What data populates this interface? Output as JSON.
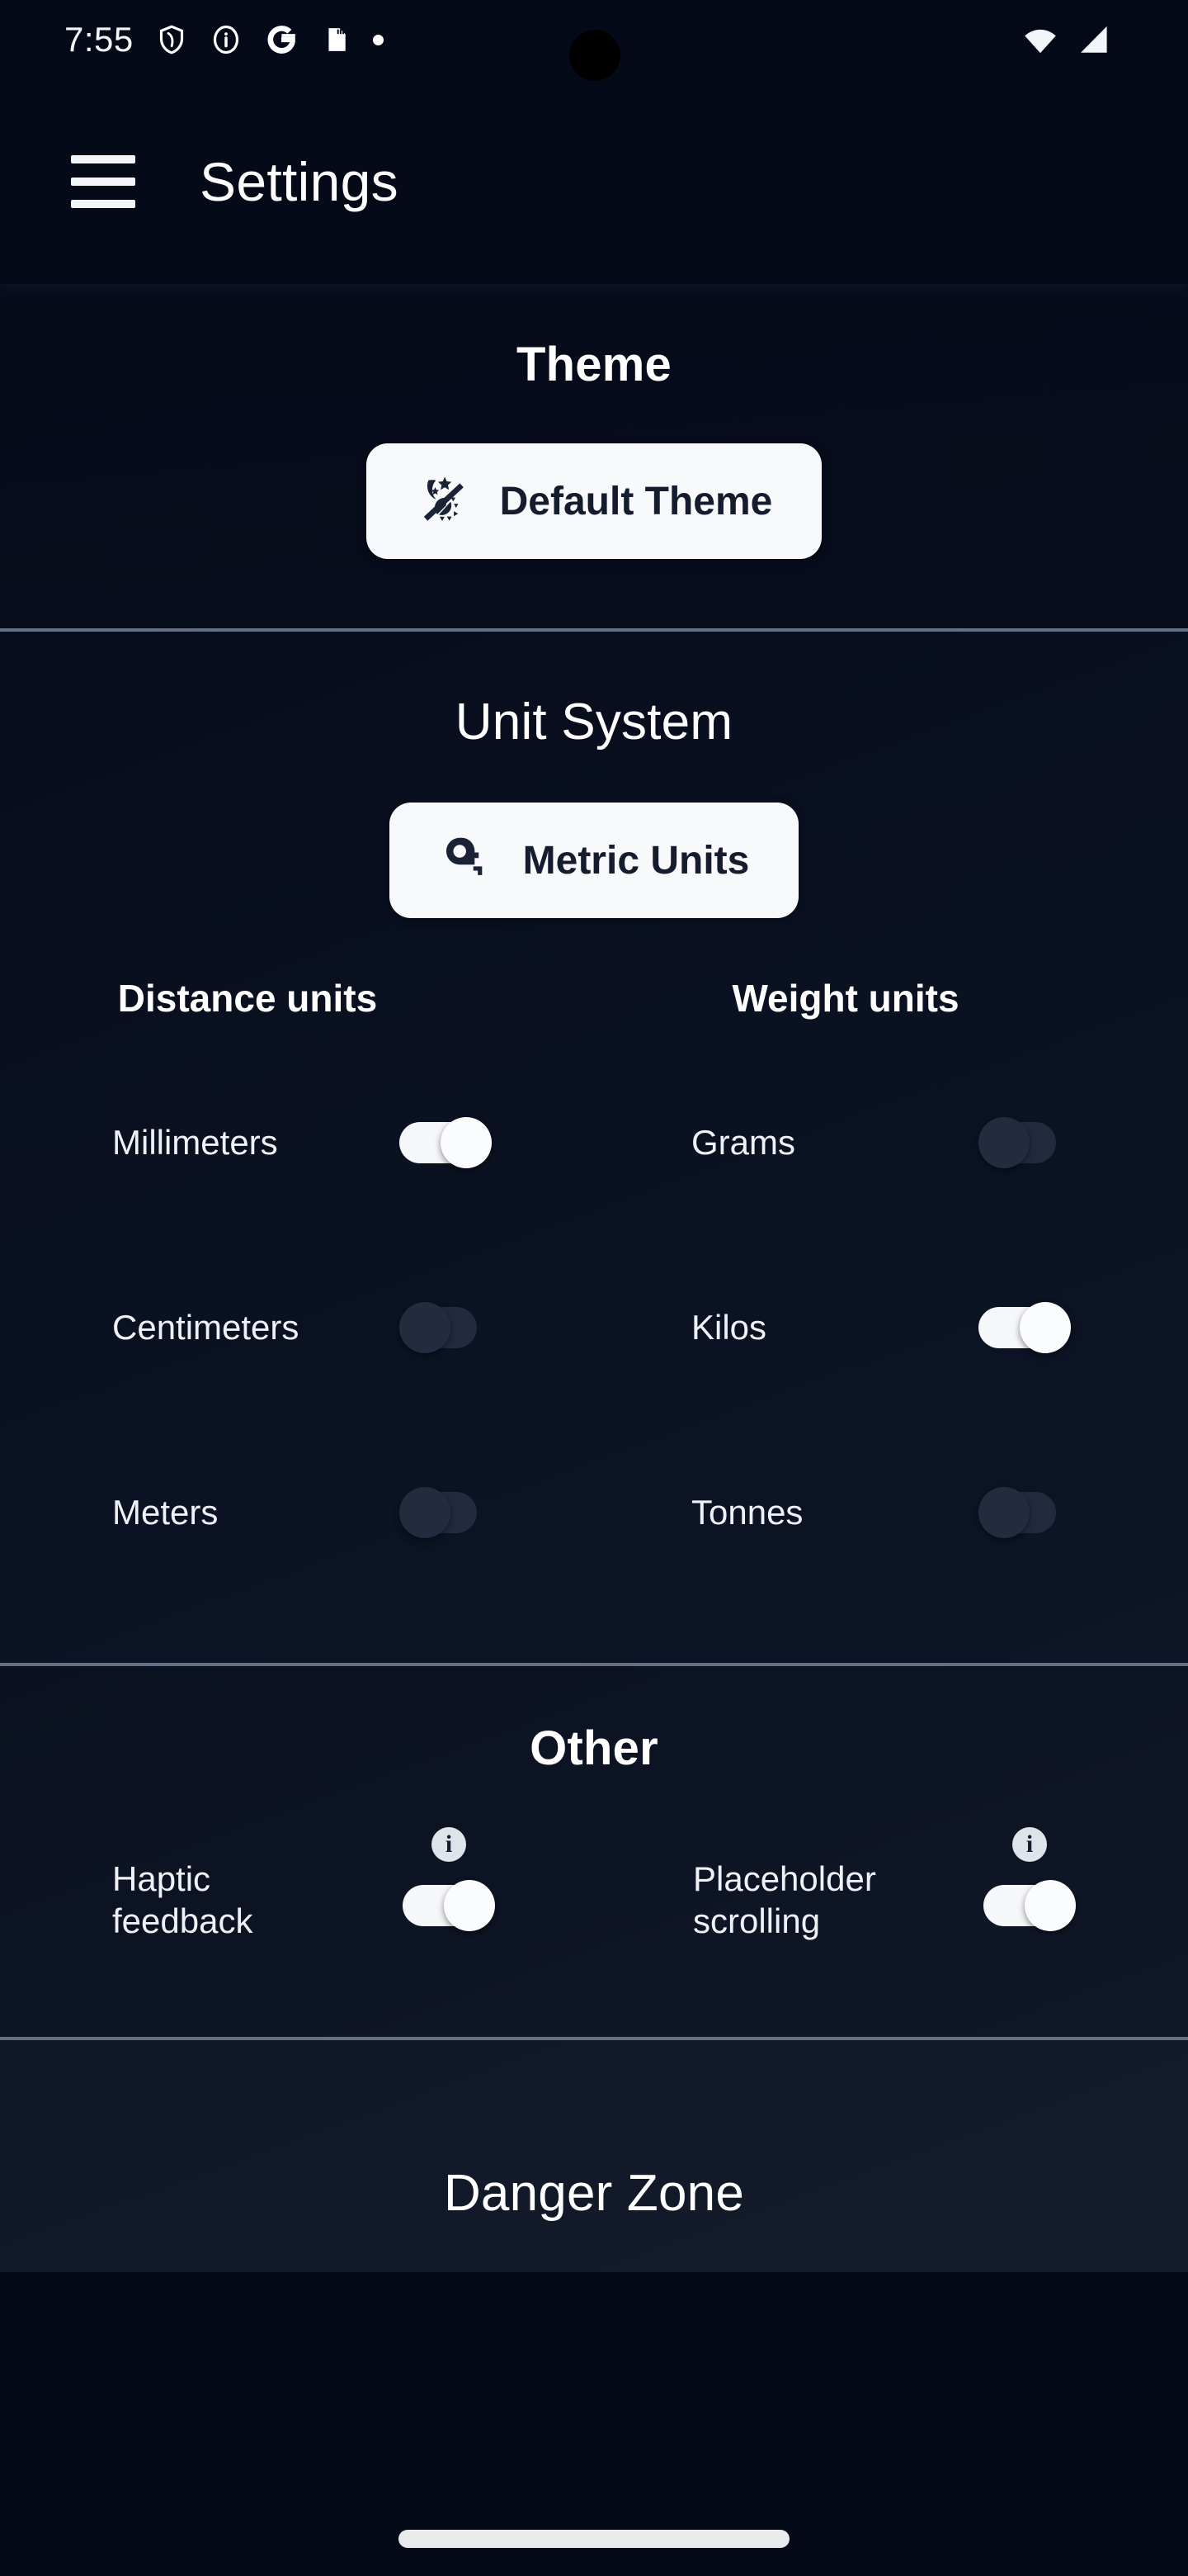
{
  "status_bar": {
    "time": "7:55",
    "left_icons": [
      "shield-icon",
      "info-circle-icon",
      "google-g-icon",
      "sd-card-icon",
      "dot-icon"
    ],
    "right_icons": [
      "wifi-icon",
      "cellular-signal-icon"
    ]
  },
  "app_bar": {
    "menu_icon": "hamburger-menu-icon",
    "title": "Settings"
  },
  "theme_section": {
    "title": "Theme",
    "button": {
      "label": "Default Theme",
      "icon": "auto-theme-moon-sun-icon"
    }
  },
  "unit_system_section": {
    "title": "Unit System",
    "button": {
      "label": "Metric Units",
      "icon": "tape-measure-icon"
    },
    "columns": [
      {
        "header": "Distance units"
      },
      {
        "header": "Weight units"
      }
    ],
    "rows": [
      {
        "distance": {
          "label": "Millimeters",
          "on": true
        },
        "weight": {
          "label": "Grams",
          "on": false
        }
      },
      {
        "distance": {
          "label": "Centimeters",
          "on": false
        },
        "weight": {
          "label": "Kilos",
          "on": true
        }
      },
      {
        "distance": {
          "label": "Meters",
          "on": false
        },
        "weight": {
          "label": "Tonnes",
          "on": false
        }
      }
    ]
  },
  "other_section": {
    "title": "Other",
    "items": [
      {
        "label": "Haptic\nfeedback",
        "on": true,
        "info_icon": "info-circle-icon"
      },
      {
        "label": "Placeholder\nscrolling",
        "on": true,
        "info_icon": "info-circle-icon"
      }
    ]
  },
  "danger_section": {
    "title": "Danger Zone"
  },
  "nav_bar": {
    "gesture_pill": "home-gesture-pill"
  },
  "colors": {
    "background": "#050a18",
    "surface_light": "#f8f9fb",
    "text_primary": "#ffffff",
    "text_on_light": "#151c2e",
    "divider": "#9eb0c8",
    "toggle_off_track": "#222b3d",
    "toggle_on_track": "#f6f7f9"
  }
}
